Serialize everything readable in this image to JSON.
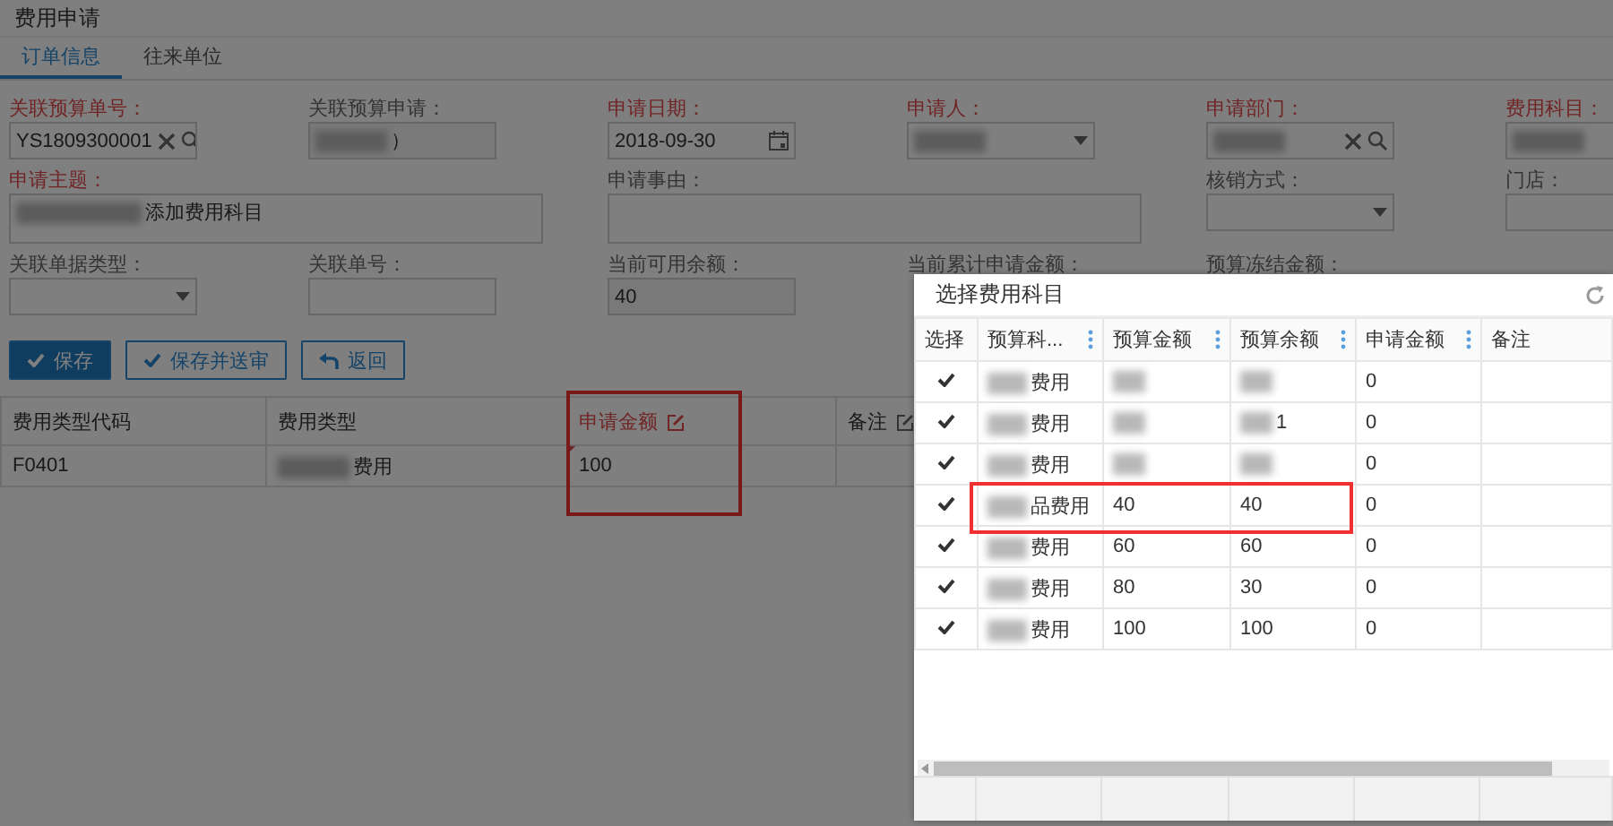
{
  "page": {
    "title": "费用申请"
  },
  "tabs": [
    {
      "label": "订单信息",
      "selected": true
    },
    {
      "label": "往来单位",
      "selected": false
    }
  ],
  "form_rows": [
    [
      {
        "label": "关联预算单号：",
        "required": true,
        "kind": "lookup",
        "value": "YS1809300001"
      },
      {
        "label": "关联预算申请：",
        "required": false,
        "kind": "text",
        "value": "）",
        "redacted": true,
        "readonly": true
      },
      {
        "label": "申请日期：",
        "required": true,
        "kind": "date",
        "value": "2018-09-30"
      },
      {
        "label": "申请人：",
        "required": true,
        "kind": "select",
        "redacted": true
      },
      {
        "label": "申请部门：",
        "required": true,
        "kind": "lookup",
        "redacted": true
      },
      {
        "label": "费用科目：",
        "required": true,
        "kind": "text",
        "redacted": true
      }
    ],
    [
      {
        "label": "申请主题：",
        "required": true,
        "kind": "textarea",
        "value": "添加费用科目",
        "redacted": true
      },
      {
        "label": "申请事由：",
        "required": false,
        "kind": "textarea"
      },
      {
        "label": "核销方式：",
        "required": false,
        "kind": "select"
      },
      {
        "label": "门店：",
        "required": false,
        "kind": "text"
      }
    ],
    [
      {
        "label": "关联单据类型：",
        "required": false,
        "kind": "select"
      },
      {
        "label": "关联单号：",
        "required": false,
        "kind": "text"
      },
      {
        "label": "当前可用余额：",
        "required": false,
        "kind": "text",
        "value": "40",
        "readonly": true
      },
      {
        "label": "当前累计申请金额：",
        "required": false,
        "kind": "hidden"
      },
      {
        "label": "预算冻结金额：",
        "required": false,
        "kind": "hidden"
      }
    ]
  ],
  "buttons": [
    {
      "label": "保存",
      "kind": "primary"
    },
    {
      "label": "保存并送审",
      "kind": "secondary"
    },
    {
      "label": "返回",
      "kind": "return"
    }
  ],
  "grid": {
    "columns": [
      {
        "label": "费用类型代码",
        "required": false,
        "editable": false,
        "highlighted": false
      },
      {
        "label": "费用类型",
        "required": false,
        "editable": false,
        "highlighted": false
      },
      {
        "label": "申请金额",
        "required": true,
        "editable": true,
        "highlighted": true
      },
      {
        "label": "备注",
        "required": false,
        "editable": true,
        "highlighted": false
      }
    ],
    "rows": [
      {
        "code": "F0401",
        "type": "费用",
        "type_redacted": true,
        "amount": "100",
        "amount_edited": true
      }
    ]
  },
  "dialog": {
    "title": "选择费用科目",
    "columns": [
      {
        "label": "选择",
        "menu": false
      },
      {
        "label": "预算科...",
        "menu": true
      },
      {
        "label": "预算金额",
        "menu": true
      },
      {
        "label": "预算余额",
        "menu": true
      },
      {
        "label": "申请金额",
        "menu": true
      },
      {
        "label": "备注",
        "menu": false
      }
    ],
    "rows": [
      {
        "checked": true,
        "subject": "费用",
        "subject_redacted": true,
        "budget_redacted": true,
        "remaining_redacted": true,
        "applied": "0",
        "highlighted": false
      },
      {
        "checked": true,
        "subject": "费用",
        "subject_redacted": true,
        "budget_redacted": true,
        "remaining": "1",
        "remaining_redacted": true,
        "applied": "0",
        "highlighted": false
      },
      {
        "checked": true,
        "subject": "费用",
        "subject_redacted": true,
        "budget_redacted": true,
        "remaining_redacted": true,
        "applied": "0",
        "highlighted": false
      },
      {
        "checked": true,
        "subject": "品费用",
        "subject_redacted": true,
        "budget": "40",
        "remaining": "40",
        "applied": "0",
        "highlighted": true
      },
      {
        "checked": true,
        "subject": "费用",
        "subject_redacted": true,
        "budget": "60",
        "remaining": "60",
        "applied": "0",
        "highlighted": false
      },
      {
        "checked": true,
        "subject": "费用",
        "subject_redacted": true,
        "budget": "80",
        "remaining": "30",
        "applied": "0",
        "highlighted": false
      },
      {
        "checked": true,
        "subject": "费用",
        "subject_redacted": true,
        "budget": "100",
        "remaining": "100",
        "applied": "0",
        "highlighted": false
      }
    ]
  }
}
